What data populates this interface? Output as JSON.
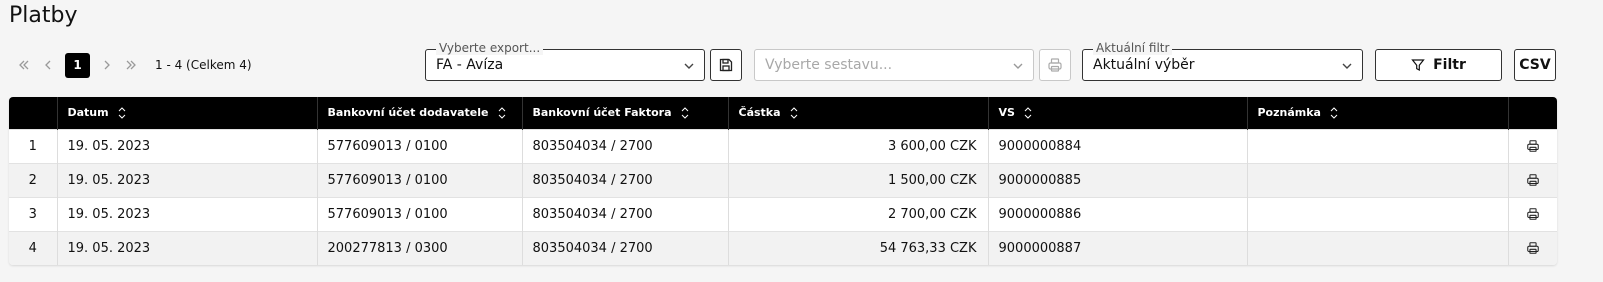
{
  "page": {
    "title": "Platby"
  },
  "pager": {
    "current_page": "1",
    "range_text": "1 - 4 (Celkem 4)"
  },
  "export_select": {
    "legend": "Vyberte export...",
    "value": "FA - Avíza"
  },
  "report_select": {
    "placeholder": "Vyberte sestavu..."
  },
  "filter_select": {
    "legend": "Aktuální filtr",
    "value": "Aktuální výběr"
  },
  "buttons": {
    "filter_label": "Filtr",
    "csv_label": "CSV"
  },
  "icons": {
    "first_page": "double-chevron-left-icon",
    "prev_page": "chevron-left-icon",
    "next_page": "chevron-right-icon",
    "last_page": "double-chevron-right-icon",
    "save": "floppy-disk-icon",
    "print": "printer-icon",
    "filter": "funnel-icon",
    "sort": "sort-arrows-icon",
    "dropdown": "chevron-down-icon"
  },
  "table": {
    "columns": [
      "",
      "Datum",
      "Bankovní účet dodavatele",
      "Bankovní účet Faktora",
      "Částka",
      "VS",
      "Poznámka",
      ""
    ],
    "rows": [
      {
        "num": "1",
        "date": "19. 05. 2023",
        "supplier_account": "577609013 / 0100",
        "factor_account": "803504034 / 2700",
        "amount": "3 600,00 CZK",
        "vs": "9000000884",
        "note": ""
      },
      {
        "num": "2",
        "date": "19. 05. 2023",
        "supplier_account": "577609013 / 0100",
        "factor_account": "803504034 / 2700",
        "amount": "1 500,00 CZK",
        "vs": "9000000885",
        "note": ""
      },
      {
        "num": "3",
        "date": "19. 05. 2023",
        "supplier_account": "577609013 / 0100",
        "factor_account": "803504034 / 2700",
        "amount": "2 700,00 CZK",
        "vs": "9000000886",
        "note": ""
      },
      {
        "num": "4",
        "date": "19. 05. 2023",
        "supplier_account": "200277813 / 0300",
        "factor_account": "803504034 / 2700",
        "amount": "54 763,33 CZK",
        "vs": "9000000887",
        "note": ""
      }
    ]
  },
  "colors": {
    "header_bg": "#000000",
    "page_bg": "#f5f5f5",
    "row_alt": "#f2f2f2"
  }
}
